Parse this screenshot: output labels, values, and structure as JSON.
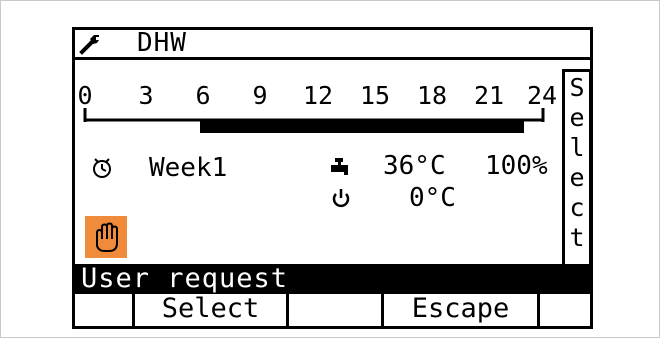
{
  "header": {
    "title": "DHW",
    "icon": "wrench-icon"
  },
  "timeline": {
    "ticks": [
      "0",
      "3",
      "6",
      "9",
      "12",
      "15",
      "18",
      "21",
      "24"
    ],
    "active_from_hour": 6,
    "active_to_hour": 23
  },
  "side_panel": {
    "label_letters": [
      "S",
      "e",
      "l",
      "e",
      "c",
      "t"
    ]
  },
  "program": {
    "icon": "clock-icon",
    "name": "Week1",
    "manual_icon": "hand-icon",
    "manual_color": "#ef8b3a"
  },
  "readings": {
    "tap_icon": "faucet-icon",
    "temperature": "36°C",
    "percent": "100%",
    "power_icon": "power-icon",
    "power_temperature": "0°C"
  },
  "status": {
    "text": "User request"
  },
  "softkeys": {
    "key1": "",
    "key2": "Select",
    "key3": "",
    "key4": "Escape",
    "key5": ""
  }
}
